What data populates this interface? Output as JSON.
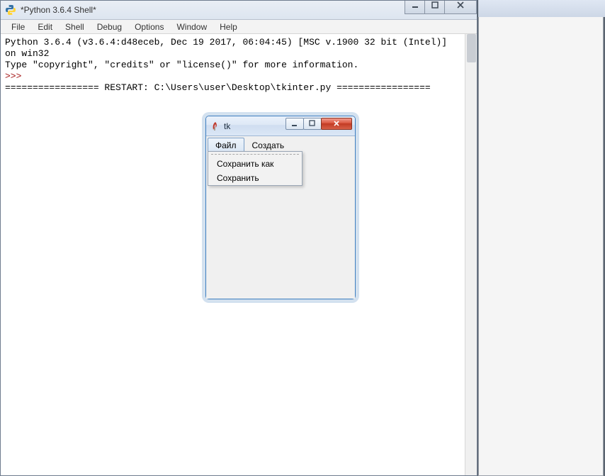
{
  "ghost": {
    "min": "—",
    "max": "▭",
    "close": "✕"
  },
  "idle": {
    "title": "*Python 3.6.4 Shell*",
    "menus": [
      "File",
      "Edit",
      "Shell",
      "Debug",
      "Options",
      "Window",
      "Help"
    ],
    "line1": "Python 3.6.4 (v3.6.4:d48eceb, Dec 19 2017, 06:04:45) [MSC v.1900 32 bit (Intel)]",
    "line2": " on win32",
    "line3": "Type \"copyright\", \"credits\" or \"license()\" for more information.",
    "prompt1": ">>> ",
    "restart": "================= RESTART: C:\\Users\\user\\Desktop\\tkinter.py =================",
    "prompt2": ""
  },
  "tk": {
    "title": "tk",
    "menus": {
      "file": "Файл",
      "create": "Создать"
    },
    "dropdown": {
      "save_as": "Сохранить как",
      "save": "Сохранить"
    }
  }
}
